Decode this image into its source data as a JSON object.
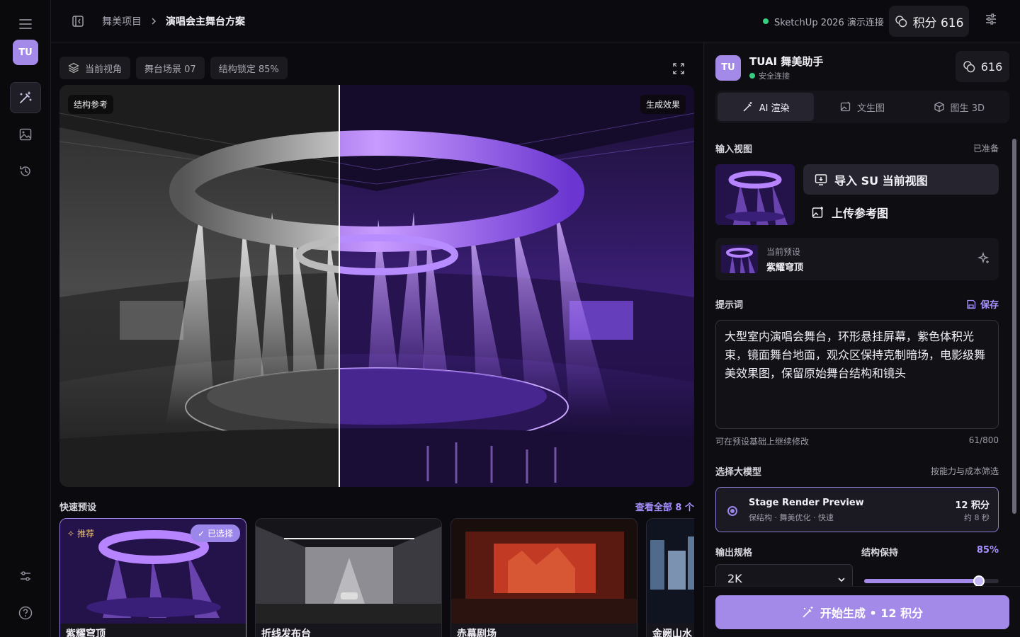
{
  "topbar": {
    "crumb_project": "舞美项目",
    "crumb_current": "演唱会主舞台方案",
    "connection": "SketchUp 2026 演示连接",
    "credits_label": "积分 616"
  },
  "sidebar": {
    "avatar": "TU"
  },
  "viewer": {
    "chips": [
      "当前视角",
      "舞台场景 07",
      "结构锁定 85%"
    ],
    "left_tag": "结构参考",
    "right_tag": "生成效果"
  },
  "quick": {
    "title": "快速预设",
    "view_all": "查看全部 8 个",
    "cards": [
      {
        "label": "紫耀穹顶",
        "badge": "推荐",
        "selected": "已选择"
      },
      {
        "label": "折线发布台"
      },
      {
        "label": "赤幕剧场"
      },
      {
        "label": "金阙山水"
      }
    ]
  },
  "panel": {
    "avatar": "TU",
    "name": "TUAI 舞美助手",
    "status": "安全连接",
    "credits": "616",
    "tabs": [
      "AI 渲染",
      "文生图",
      "图生 3D"
    ],
    "input_view": {
      "label": "输入视图",
      "state": "已准备",
      "import": "导入 SU 当前视图",
      "upload": "上传参考图"
    },
    "preset": {
      "key": "当前预设",
      "value": "紫耀穹顶"
    },
    "prompt": {
      "label": "提示词",
      "save": "保存",
      "text": "大型室内演唱会舞台，环形悬挂屏幕，紫色体积光束，镜面舞台地面，观众区保持克制暗场，电影级舞美效果图，保留原始舞台结构和镜头",
      "hint": "可在预设基础上继续修改",
      "count": "61/800"
    },
    "model": {
      "label": "选择大模型",
      "filter": "按能力与成本筛选",
      "name": "Stage Render Preview",
      "sub": "保结构 · 舞美优化 · 快速",
      "cost": "12 积分",
      "time": "约 8 秒"
    },
    "output": {
      "label": "输出规格",
      "value": "2K"
    },
    "structure": {
      "label": "结构保持",
      "value": "85%",
      "level": 0.85
    },
    "generate": "开始生成 • 12 积分"
  }
}
